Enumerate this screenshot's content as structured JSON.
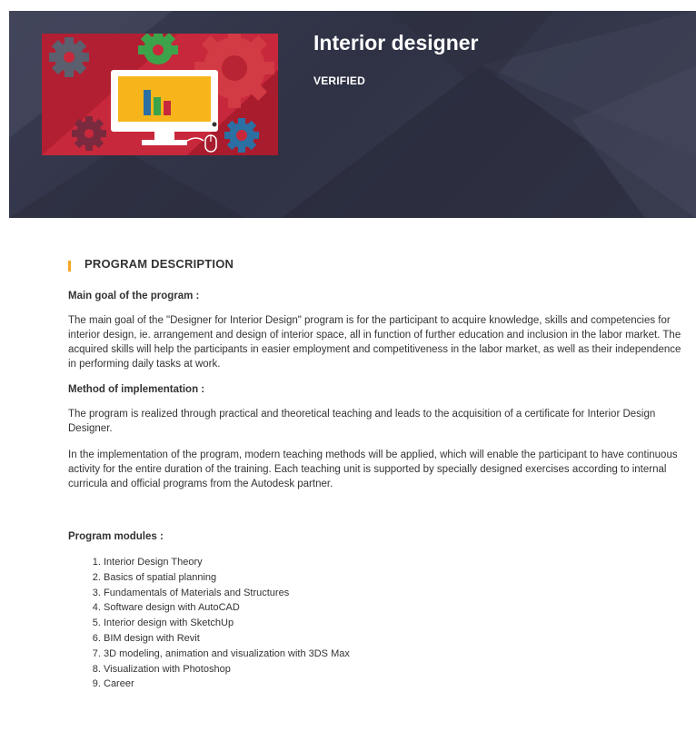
{
  "hero": {
    "title": "Interior designer",
    "badge": "VERIFIED",
    "colors": {
      "background": "#33364a",
      "thumbnail": "#c8283b",
      "accent": "#f5a623"
    }
  },
  "thumbnail_icons": [
    "gear-icon",
    "monitor-icon",
    "bar-chart-icon",
    "mouse-icon"
  ],
  "section": {
    "title": "PROGRAM DESCRIPTION"
  },
  "main_goal": {
    "heading": "Main goal of the program :",
    "text": "The main goal of the \"Designer for Interior Design\" program is for the participant to acquire knowledge, skills and competencies for interior design, ie. arrangement and design of interior space, all in function of further education and inclusion in the labor market. The acquired skills will help the participants in easier employment and competitiveness in the labor market, as well as their independence in performing daily tasks at work."
  },
  "method": {
    "heading": "Method of implementation :",
    "text1": "The program is realized through practical and theoretical teaching and leads to the acquisition of a certificate for Interior Design Designer.",
    "text2": "In the implementation of the program, modern teaching methods will be applied, which will enable the participant to have continuous activity for the entire duration of the training. Each teaching unit is supported by specially designed exercises according to internal curricula and official programs from the Autodesk partner."
  },
  "modules": {
    "heading": "Program modules :",
    "items": [
      "Interior Design Theory",
      "Basics of spatial planning",
      "Fundamentals of Materials and Structures",
      "Software design with AutoCAD",
      "Interior design with SketchUp",
      "BIM design with Revit",
      "3D modeling, animation and visualization with 3DS Max",
      "Visualization with Photoshop",
      "Career"
    ]
  }
}
